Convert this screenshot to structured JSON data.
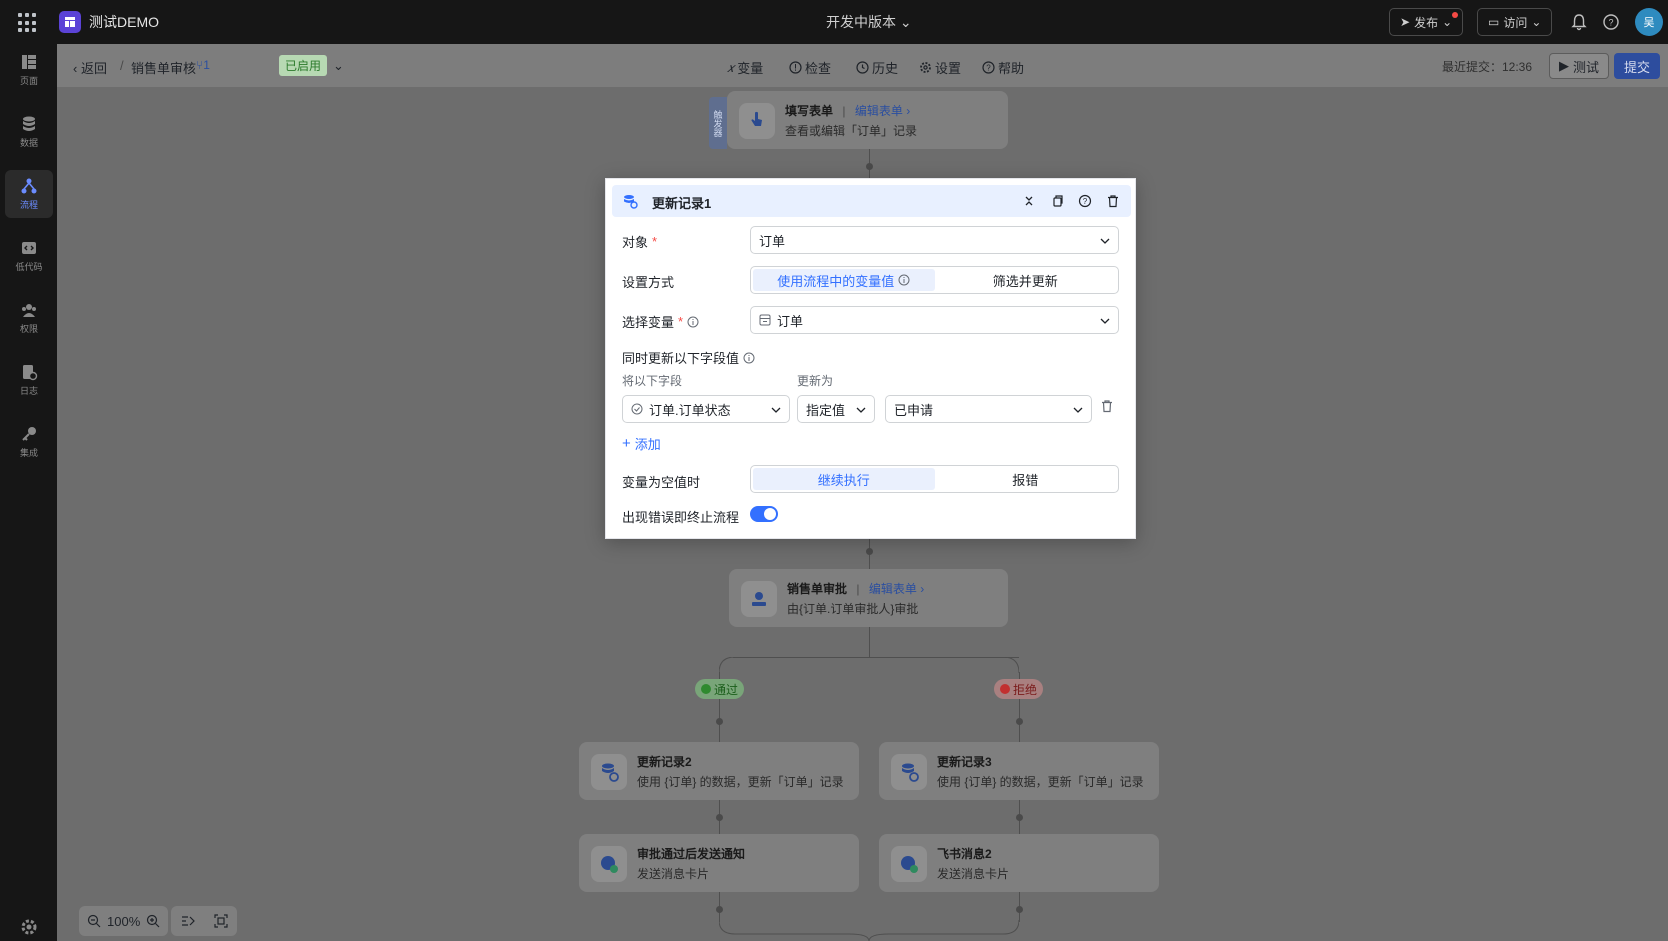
{
  "topbar": {
    "app_name": "测试DEMO",
    "version": "开发中版本",
    "publish_label": "发布",
    "visit_label": "访问",
    "avatar_text": "吴"
  },
  "sidebar": {
    "items": [
      {
        "label": "页面",
        "icon": "pages-icon"
      },
      {
        "label": "数据",
        "icon": "database-icon"
      },
      {
        "label": "流程",
        "icon": "flow-icon",
        "active": true
      },
      {
        "label": "低代码",
        "icon": "code-icon"
      },
      {
        "label": "权限",
        "icon": "users-icon"
      },
      {
        "label": "日志",
        "icon": "log-icon"
      },
      {
        "label": "集成",
        "icon": "key-icon"
      }
    ]
  },
  "subbar": {
    "back_label": "返回",
    "flow_name": "销售单审核",
    "version_num": "1",
    "status_badge": "已启用",
    "tools": [
      "变量",
      "检查",
      "历史",
      "设置",
      "帮助"
    ],
    "last_submit": "最近提交：12:36",
    "test_label": "测试",
    "submit_label": "提交"
  },
  "canvas": {
    "trigger_tag": "触发器",
    "trigger_node": {
      "title": "填写表单",
      "link": "编辑表单",
      "sub": "查看或编辑「订单」记录"
    },
    "approval_node": {
      "title": "销售单审批",
      "link": "编辑表单",
      "sub": "由{订单.订单审批人}审批"
    },
    "branch_pass": "通过",
    "branch_reject": "拒绝",
    "update2": {
      "title": "更新记录2",
      "sub": "使用 {订单} 的数据，更新「订单」记录"
    },
    "update3": {
      "title": "更新记录3",
      "sub": "使用 {订单} 的数据，更新「订单」记录"
    },
    "notify": {
      "title": "审批通过后发送通知",
      "sub": "发送消息卡片"
    },
    "feishu": {
      "title": "飞书消息2",
      "sub": "发送消息卡片"
    },
    "zoom": "100%"
  },
  "modal": {
    "title": "更新记录1",
    "object_label": "对象",
    "object_value": "订单",
    "mode_label": "设置方式",
    "mode_option1": "使用流程中的变量值",
    "mode_option2": "筛选并更新",
    "var_label": "选择变量",
    "var_value": "订单",
    "fields_label": "同时更新以下字段值",
    "col_field": "将以下字段",
    "col_update": "更新为",
    "field_value": "订单.订单状态",
    "type_value": "指定值",
    "target_value": "已申请",
    "add_label": "添加",
    "null_label": "变量为空值时",
    "null_option1": "继续执行",
    "null_option2": "报错",
    "stop_label": "出现错误即终止流程"
  },
  "colors": {
    "accent": "#3370ff",
    "toggle_on": "#3370ff",
    "required": "#f54a45"
  }
}
